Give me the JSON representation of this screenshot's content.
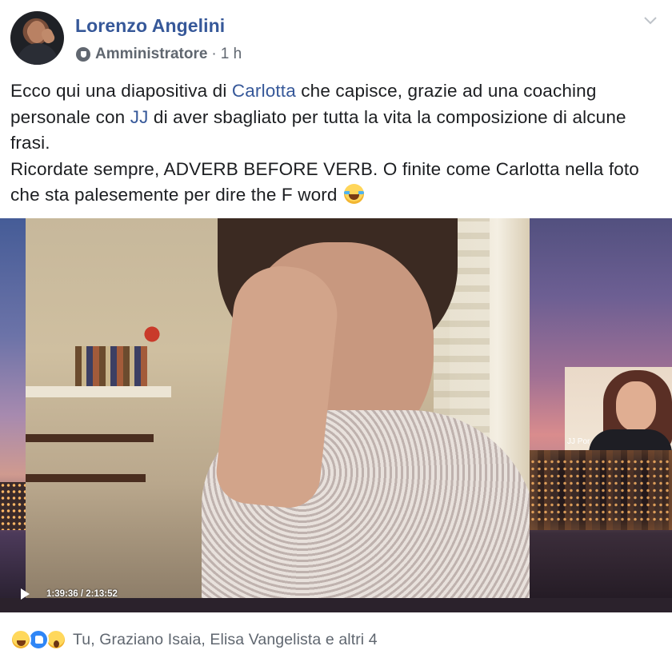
{
  "post": {
    "author": "Lorenzo Angelini",
    "role": "Amministratore",
    "separator": "·",
    "time": "1 h",
    "text": {
      "seg1": "Ecco qui una diapositiva di ",
      "link1": "Carlotta",
      "seg2": " che capisce, grazie ad una coaching personale con ",
      "link2": "JJ",
      "seg3": " di aver sbagliato per tutta la vita la composizione di alcune frasi.",
      "line2": "Ricordate sempre, ADVERB BEFORE VERB. O finite come Carlotta nella foto che sta palesemente per dire the F word "
    },
    "text_emoji": "face-with-tears-of-joy-icon"
  },
  "video": {
    "current_time": "1:39:36",
    "separator": " / ",
    "duration": "2:13:52",
    "pip_label": "JJ Por"
  },
  "reactions": {
    "icons": [
      "haha-icon",
      "like-icon",
      "wow-icon"
    ],
    "names": "Tu, Graziano Isaia, Elisa Vangelista e altri 4"
  },
  "colors": {
    "link": "#365899",
    "meta": "#606770",
    "text": "#1c1e21"
  }
}
